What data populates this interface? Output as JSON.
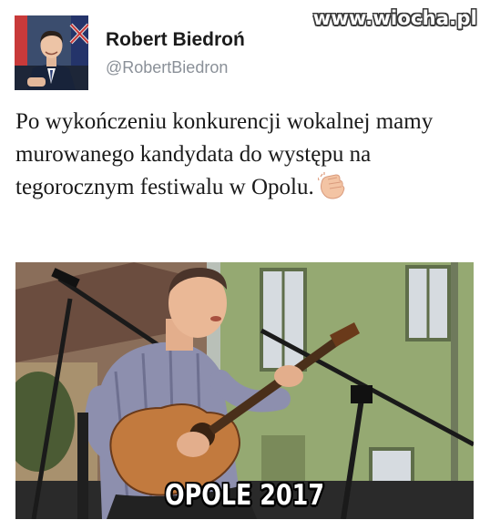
{
  "tweet": {
    "author_name": "Robert Biedroń",
    "author_handle": "@RobertBiedron",
    "text": "Po wykończeniu konkurencji wokalnej mamy murowanego kandydata do występu na tegorocznym festiwalu w Opolu.",
    "emoji": "clapping-hands-icon"
  },
  "photo": {
    "caption": "OPOLE 2017",
    "description": "man-playing-guitar-at-microphone"
  },
  "watermark": "www.wiocha.pl",
  "colors": {
    "name": "#1b1b1b",
    "handle": "#8a9098",
    "text": "#1a1a1a",
    "watermark_outline": "#3a3a3a"
  }
}
